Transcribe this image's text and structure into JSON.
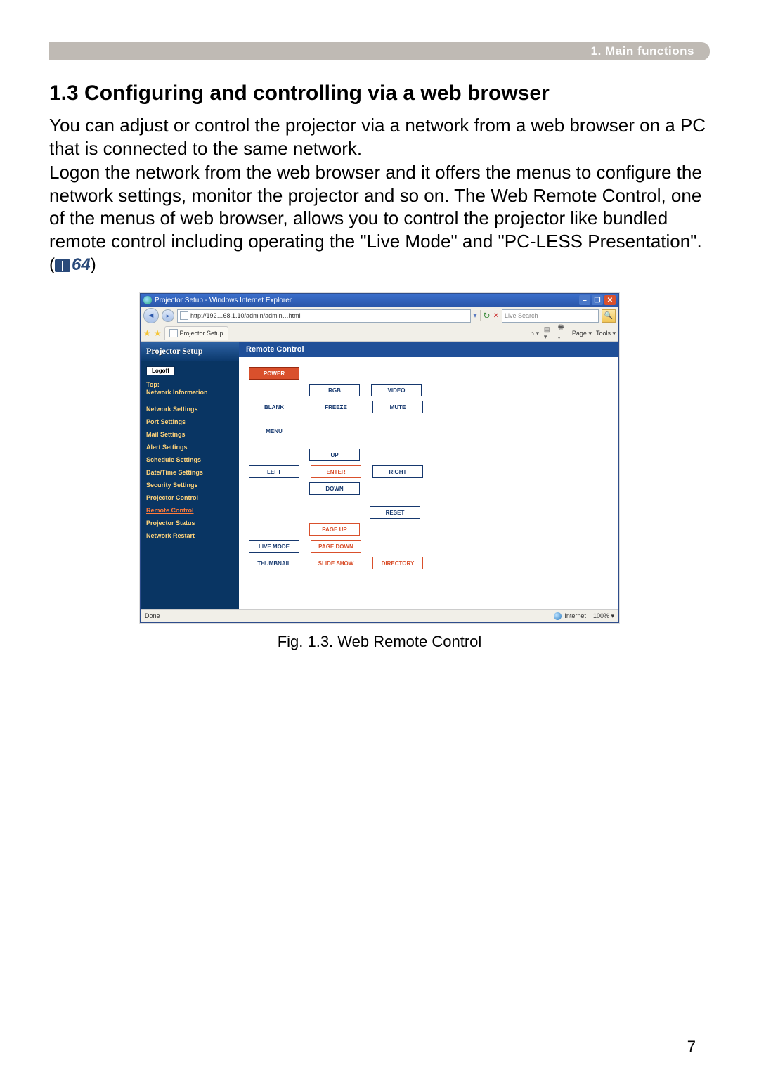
{
  "header": {
    "chapter": "1. Main functions"
  },
  "section": {
    "title": "1.3 Configuring and controlling via a web browser",
    "para1": "You can adjust or control the projector via a network from a web browser on a PC that is connected to the same network.",
    "para2": "Logon the network from the web browser and it offers the menus to configure the network settings, monitor the projector and so on. The Web Remote Control, one of the menus of web browser, allows you to control the projector like bundled remote control including operating the \"Live Mode\" and \"PC-LESS Presentation\".",
    "ref_open": "(",
    "ref_num": "64",
    "ref_close": ")"
  },
  "figure_caption": "Fig. 1.3. Web Remote Control",
  "page_number": "7",
  "ie": {
    "title": "Projector Setup - Windows Internet Explorer",
    "win_min": "–",
    "win_max": "❐",
    "win_close": "✕",
    "nav_back": "◄",
    "nav_fwd": "▸",
    "address": "http://192…68.1.10/admin/admin…html",
    "addr_dd": "▾",
    "refresh": "↻",
    "stop": "✕",
    "search_placeholder": "Live Search",
    "go": "🔍",
    "star1": "★",
    "star2": "★",
    "tab_label": "Projector Setup",
    "tools": {
      "home": "⌂ ▾",
      "feed": "▤ ▾",
      "print": "🖶 ▾",
      "page": "Page ▾",
      "tools": "Tools ▾"
    },
    "status_left": "Done",
    "status_zone": "Internet",
    "status_zoom": "100%  ▾"
  },
  "sidebar": {
    "title": "Projector Setup",
    "logoff": "Logoff",
    "top_label": "Top:",
    "top_sub": "Network Information",
    "items": [
      "Network Settings",
      "Port Settings",
      "Mail Settings",
      "Alert Settings",
      "Schedule Settings",
      "Date/Time Settings",
      "Security Settings",
      "Projector Control",
      "Remote Control",
      "Projector Status",
      "Network Restart"
    ],
    "active_index": 8
  },
  "remote": {
    "heading": "Remote Control",
    "power": "POWER",
    "rgb": "RGB",
    "video": "VIDEO",
    "blank": "BLANK",
    "freeze": "FREEZE",
    "mute": "MUTE",
    "menu": "MENU",
    "up": "UP",
    "left": "LEFT",
    "enter": "ENTER",
    "right": "RIGHT",
    "down": "DOWN",
    "reset": "RESET",
    "page_up": "PAGE UP",
    "live_mode": "LIVE MODE",
    "page_down": "PAGE DOWN",
    "thumbnail": "THUMBNAIL",
    "slide_show": "SLIDE SHOW",
    "directory": "DIRECTORY"
  }
}
